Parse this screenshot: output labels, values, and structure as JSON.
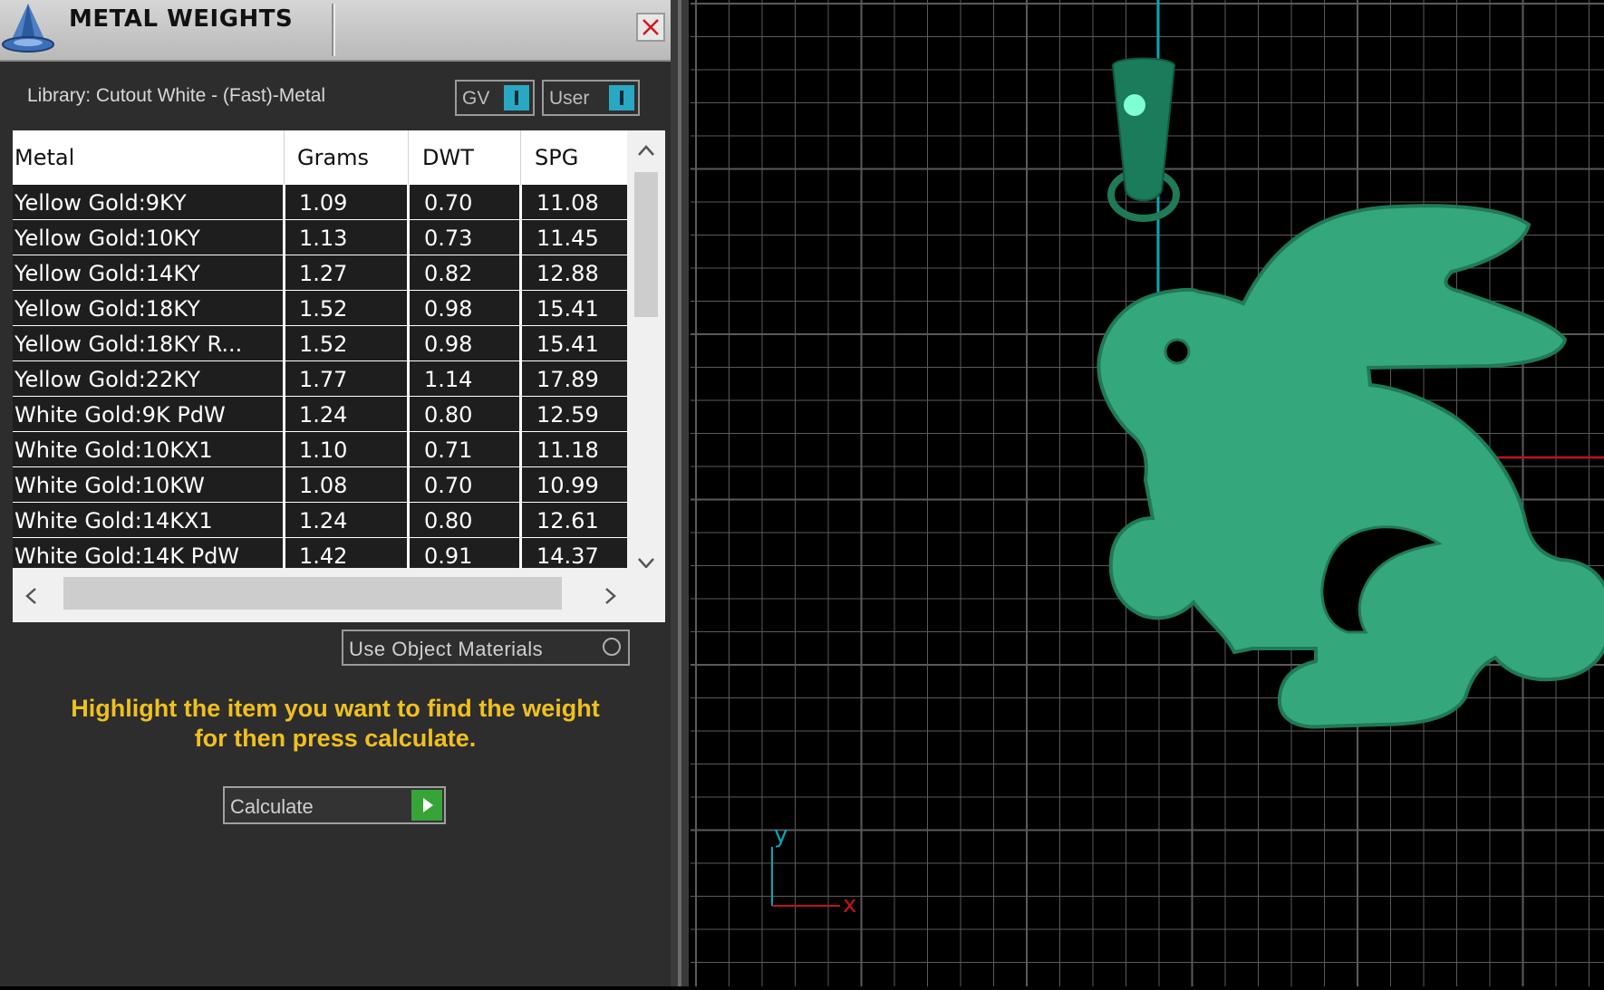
{
  "window": {
    "title": "METAL WEIGHTS",
    "close_icon": "close-icon"
  },
  "library": {
    "label": "Library: Cutout White - (Fast)-Metal",
    "gv_label": "GV",
    "user_label": "User"
  },
  "table": {
    "headers": [
      "Metal",
      "Grams",
      "DWT",
      "SPG"
    ],
    "rows": [
      {
        "metal": "Yellow Gold:9KY",
        "grams": "1.09",
        "dwt": "0.70",
        "spg": "11.08"
      },
      {
        "metal": "Yellow Gold:10KY",
        "grams": "1.13",
        "dwt": "0.73",
        "spg": "11.45"
      },
      {
        "metal": "Yellow Gold:14KY",
        "grams": "1.27",
        "dwt": "0.82",
        "spg": "12.88"
      },
      {
        "metal": "Yellow Gold:18KY",
        "grams": "1.52",
        "dwt": "0.98",
        "spg": "15.41"
      },
      {
        "metal": "Yellow Gold:18KY R...",
        "grams": "1.52",
        "dwt": "0.98",
        "spg": "15.41"
      },
      {
        "metal": "Yellow Gold:22KY",
        "grams": "1.77",
        "dwt": "1.14",
        "spg": "17.89"
      },
      {
        "metal": "White Gold:9K PdW",
        "grams": "1.24",
        "dwt": "0.80",
        "spg": "12.59"
      },
      {
        "metal": "White Gold:10KX1",
        "grams": "1.10",
        "dwt": "0.71",
        "spg": "11.18"
      },
      {
        "metal": "White Gold:10KW",
        "grams": "1.08",
        "dwt": "0.70",
        "spg": "10.99"
      },
      {
        "metal": "White Gold:14KX1",
        "grams": "1.24",
        "dwt": "0.80",
        "spg": "12.61"
      },
      {
        "metal": "White Gold:14K PdW",
        "grams": "1.42",
        "dwt": "0.91",
        "spg": "14.37"
      }
    ]
  },
  "options": {
    "use_object_materials": "Use Object Materials"
  },
  "hint": {
    "line1": "Highlight the item you want to find the weight",
    "line2": "for then press calculate."
  },
  "actions": {
    "calculate": "Calculate"
  },
  "viewport": {
    "axis_y": "y",
    "axis_x": "x",
    "model_color": "#34a87c",
    "grid_color": "#5a5a5a",
    "x_axis_color": "#c0151a",
    "y_axis_color": "#0aa6b3"
  }
}
